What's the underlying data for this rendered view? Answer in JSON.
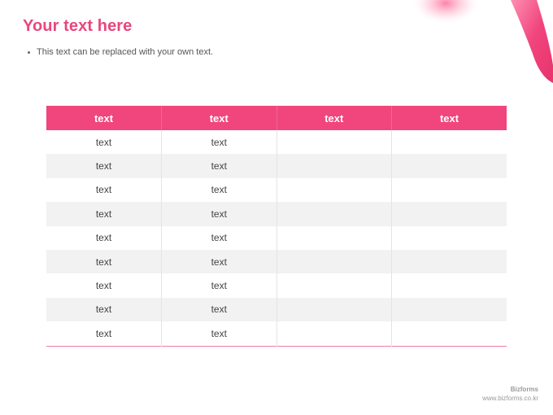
{
  "slide": {
    "title": "Your text here",
    "bullet": "This text can be replaced with your own text."
  },
  "table": {
    "headers": [
      "text",
      "text",
      "text",
      "text"
    ],
    "rows": [
      [
        "text",
        "text",
        "",
        ""
      ],
      [
        "text",
        "text",
        "",
        ""
      ],
      [
        "text",
        "text",
        "",
        ""
      ],
      [
        "text",
        "text",
        "",
        ""
      ],
      [
        "text",
        "text",
        "",
        ""
      ],
      [
        "text",
        "text",
        "",
        ""
      ],
      [
        "text",
        "text",
        "",
        ""
      ],
      [
        "text",
        "text",
        "",
        ""
      ],
      [
        "text",
        "text",
        "",
        ""
      ]
    ]
  },
  "footer": {
    "brand": "Bizforms",
    "url": "www.bizforms.co.kr"
  },
  "colors": {
    "accent": "#f0457d",
    "title": "#e8477f"
  }
}
